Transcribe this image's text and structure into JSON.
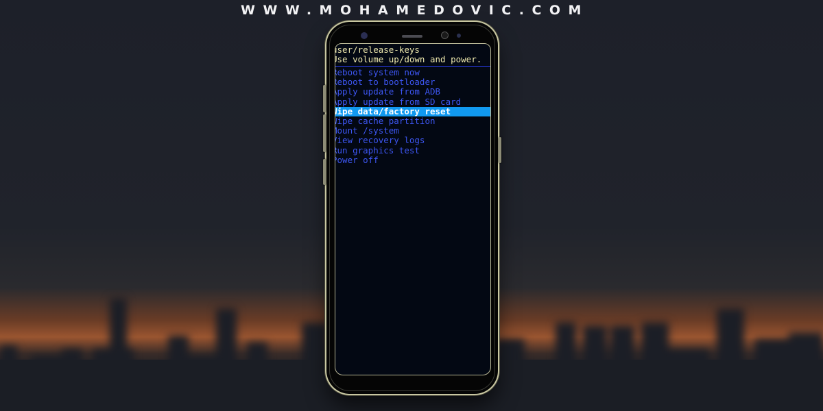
{
  "site": {
    "title": "WWW.MOHAMEDOVIC.COM"
  },
  "phone": {
    "recovery": {
      "header_lines": [
        "user/release-keys",
        "Use volume up/down and power."
      ],
      "menu": [
        {
          "label": "Reboot system now",
          "selected": false
        },
        {
          "label": "Reboot to bootloader",
          "selected": false
        },
        {
          "label": "Apply update from ADB",
          "selected": false
        },
        {
          "label": "Apply update from SD card",
          "selected": false
        },
        {
          "label": "Wipe data/factory reset",
          "selected": true
        },
        {
          "label": "Wipe cache partition",
          "selected": false
        },
        {
          "label": "Mount /system",
          "selected": false
        },
        {
          "label": "View recovery logs",
          "selected": false
        },
        {
          "label": "Run graphics test",
          "selected": false
        },
        {
          "label": "Power off",
          "selected": false
        }
      ],
      "colors": {
        "header_text": "#efe9ae",
        "menu_text": "#3d56f2",
        "highlight": "#1199f0",
        "screen_bg": "#030813"
      }
    }
  }
}
